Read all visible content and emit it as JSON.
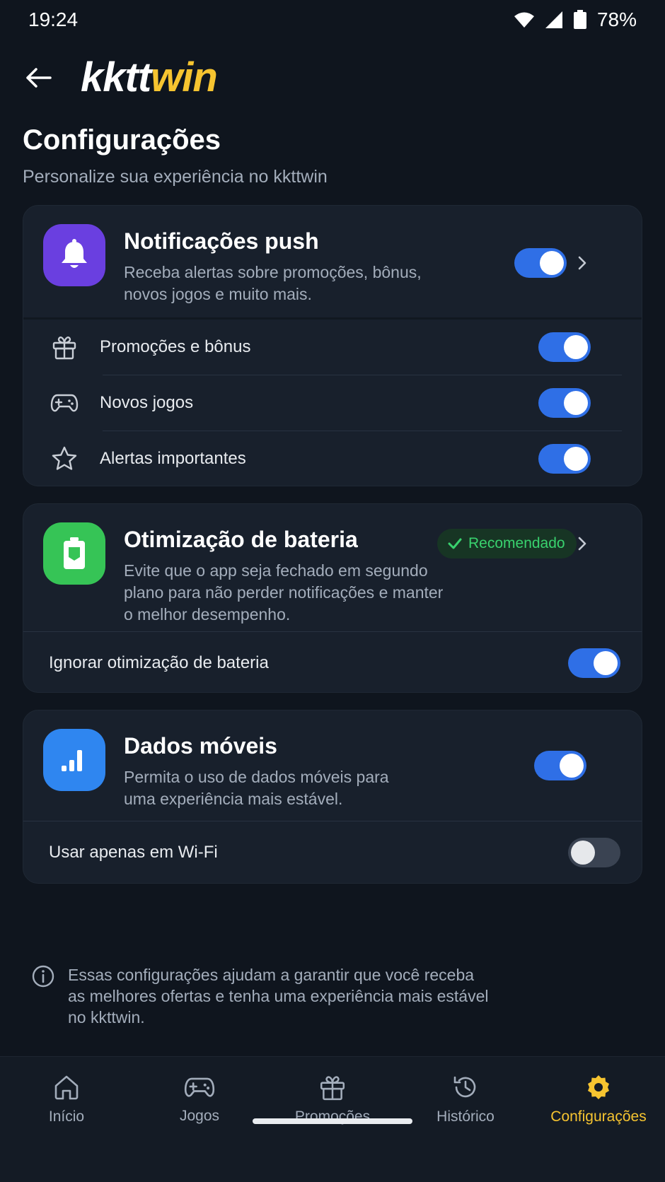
{
  "status": {
    "time": "19:24",
    "battery": "78%"
  },
  "header": {
    "logo_part1": "kktt",
    "logo_part2": "win"
  },
  "page": {
    "title": "Configurações",
    "subtitle": "Personalize sua experiência no kkttwin"
  },
  "push": {
    "title": "Notificações push",
    "desc_line1": "Receba alertas sobre promoções, bônus,",
    "desc_line2": "novos jogos e muito mais.",
    "enabled": true,
    "items": [
      {
        "label": "Promoções e bônus",
        "icon": "gift-icon",
        "enabled": true
      },
      {
        "label": "Novos jogos",
        "icon": "gamepad-icon",
        "enabled": true
      },
      {
        "label": "Alertas importantes",
        "icon": "star-icon",
        "enabled": true
      }
    ]
  },
  "battery": {
    "title": "Otimização de bateria",
    "badge": "Recomendado",
    "desc_line1": "Evite que o app seja fechado em segundo",
    "desc_line2": "plano para não perder notificações e manter",
    "desc_line3": "o melhor desempenho.",
    "row_label": "Ignorar otimização de bateria",
    "row_enabled": true
  },
  "mobile_data": {
    "title": "Dados móveis",
    "desc_line1": "Permita o uso de dados móveis para",
    "desc_line2": "uma experiência mais estável.",
    "enabled": true,
    "row_label": "Usar apenas em Wi-Fi",
    "row_enabled": false
  },
  "info": {
    "line1": "Essas configurações ajudam a garantir que você receba",
    "line2": "as melhores ofertas e tenha uma experiência mais estável",
    "line3": "no kkttwin."
  },
  "nav": {
    "items": [
      {
        "label": "Início",
        "icon": "home-icon"
      },
      {
        "label": "Jogos",
        "icon": "gamepad-icon"
      },
      {
        "label": "Promoções",
        "icon": "gift-icon"
      },
      {
        "label": "Histórico",
        "icon": "history-icon"
      },
      {
        "label": "Configurações",
        "icon": "gear-icon",
        "active": true
      }
    ]
  },
  "colors": {
    "accent": "#f6c430",
    "toggle_on": "#2f6fe6",
    "push_icon_bg": "#6a3fe0",
    "battery_icon_bg": "#36c456",
    "data_icon_bg": "#2f86f0",
    "badge_text": "#39d26e"
  }
}
